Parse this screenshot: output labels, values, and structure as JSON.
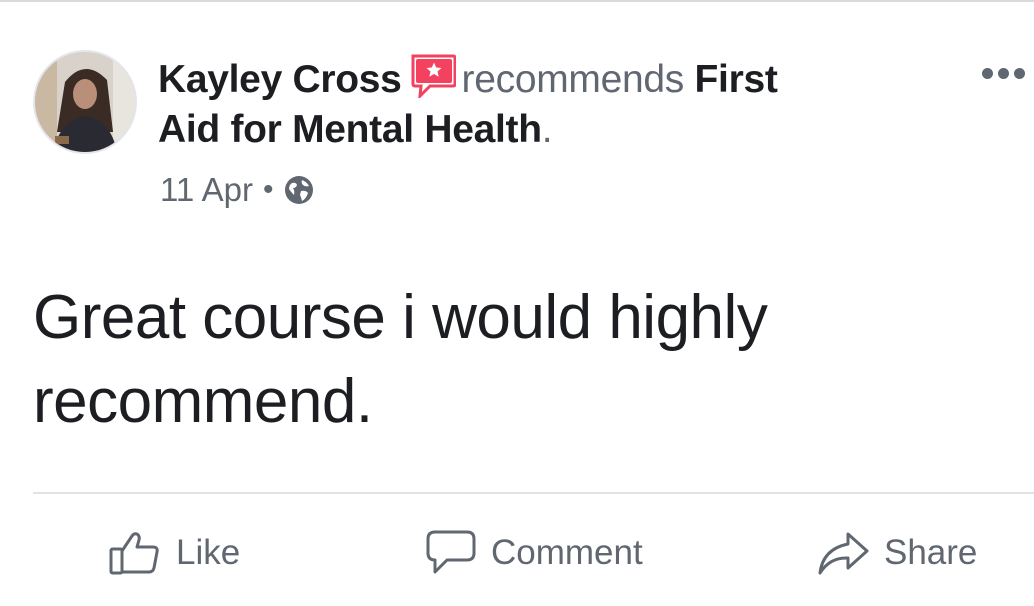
{
  "post": {
    "author": "Kayley Cross",
    "verb": "recommends",
    "page_line1": "First",
    "page_line2": "Aid for Mental Health",
    "period": ".",
    "date": "11 Apr",
    "separator": "•",
    "privacy_icon": "globe-icon",
    "recommend_icon": "recommendation-star-icon",
    "menu_icon": "more-options-icon",
    "text": "Great course i would highly recommend."
  },
  "actions": {
    "like_label": "Like",
    "comment_label": "Comment",
    "share_label": "Share",
    "like_icon": "thumbs-up-icon",
    "comment_icon": "speech-bubble-icon",
    "share_icon": "share-arrow-icon"
  },
  "colors": {
    "primary_text": "#1c1e21",
    "secondary_text": "#606770",
    "recommend_accent": "#f3425f",
    "divider": "#e1e3e6"
  }
}
